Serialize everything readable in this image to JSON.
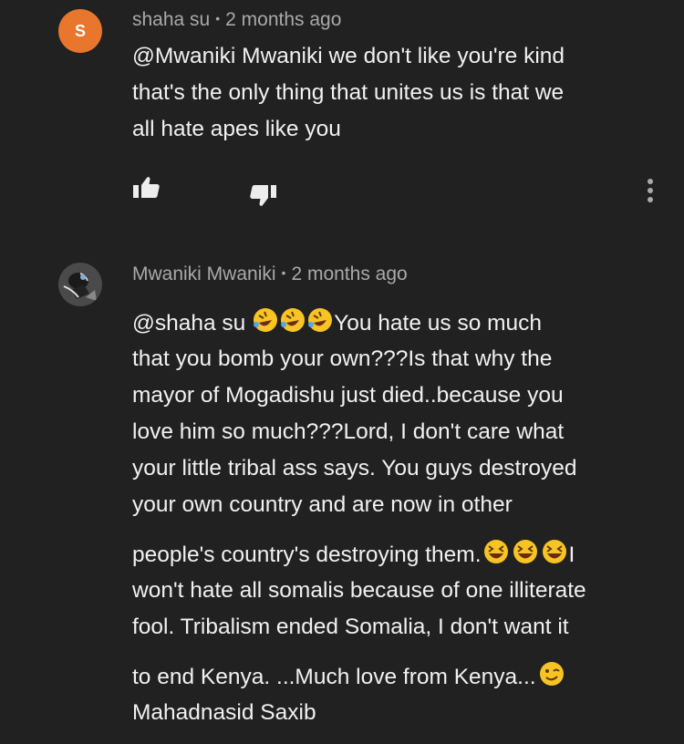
{
  "comments": [
    {
      "author": "shaha su",
      "time": "2 months ago",
      "avatar_letter": "S",
      "avatar_color": "#e8762d",
      "lines": [
        "@Mwaniki Mwaniki we don't like you're kind",
        "that's the only thing that unites us is that we",
        "all hate apes like you"
      ],
      "icons": [
        "thumbs-up-icon",
        "thumbs-down-icon",
        "more-vertical-icon"
      ]
    },
    {
      "author": "Mwaniki Mwaniki",
      "time": "2 months ago",
      "lines": {
        "l1_a": "@shaha su ",
        "l1_b": "You hate us so much",
        "l2": "that you bomb your own???Is that why the",
        "l3": "mayor of Mogadishu just died..because you",
        "l4": "love him so much???Lord, I don't care what",
        "l5": "your little tribal ass says. You guys destroyed",
        "l6": "your own country and are now in other",
        "l7_a": "people's country's destroying them.",
        "l7_b": "I",
        "l8": "won't hate all somalis because of one illiterate",
        "l9": "fool. Tribalism ended Somalia, I don't want it",
        "l10_a": "to end Kenya. ...Much love from Kenya...",
        "l11": "Mahadnasid Saxib"
      },
      "emojis": [
        "rolling-on-floor-laughing",
        "rolling-on-floor-laughing",
        "rolling-on-floor-laughing",
        "grinning-squinting",
        "grinning-squinting",
        "grinning-squinting",
        "winking-face"
      ]
    }
  ],
  "colors": {
    "background": "#212121",
    "text": "#f1f1f1",
    "meta": "#a9a9a9"
  }
}
